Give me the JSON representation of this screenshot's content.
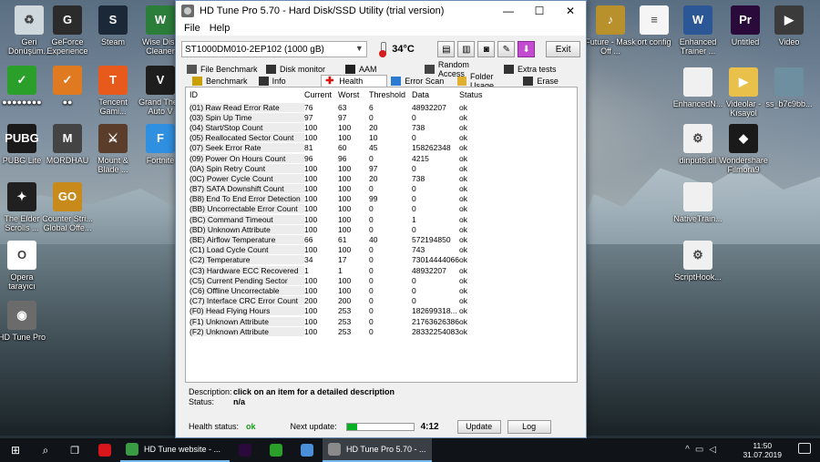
{
  "desktop": {
    "left_icons": [
      {
        "label": "Geri Dönüşüm...",
        "icon": "recycle-bin-icon",
        "color": "#cfd8dc",
        "glyph": "♻"
      },
      {
        "label": "GeForce Experience",
        "icon": "geforce-icon",
        "color": "#2b2b2b",
        "glyph": "G"
      },
      {
        "label": "Steam",
        "icon": "steam-icon",
        "color": "#1b2838",
        "glyph": "S"
      },
      {
        "label": "Wise Disk Cleaner",
        "icon": "wise-disk-cleaner-icon",
        "color": "#2b7d3a",
        "glyph": "W"
      },
      {
        "label": "●●●●●●●●",
        "icon": "check-green-icon",
        "color": "#2aa02a",
        "glyph": "✓"
      },
      {
        "label": "●●",
        "icon": "check-orange-icon",
        "color": "#e07a21",
        "glyph": "✓"
      },
      {
        "label": "Tencent Gami...",
        "icon": "tencent-gaming-icon",
        "color": "#e85a1b",
        "glyph": "T"
      },
      {
        "label": "Grand Theft Auto V",
        "icon": "gta-v-icon",
        "color": "#1e1e1e",
        "glyph": "V"
      },
      {
        "label": "PUBG Lite",
        "icon": "pubg-lite-icon",
        "color": "#1a1a1a",
        "glyph": "PUBG"
      },
      {
        "label": "MORDHAU",
        "icon": "mordhau-icon",
        "color": "#444",
        "glyph": "M"
      },
      {
        "label": "Mount & Blade ...",
        "icon": "mount-blade-icon",
        "color": "#5a3d2b",
        "glyph": "⚔"
      },
      {
        "label": "Fortnite",
        "icon": "fortnite-icon",
        "color": "#2f8fe0",
        "glyph": "F"
      },
      {
        "label": "The Elder Scrolls ...",
        "icon": "elder-scrolls-icon",
        "color": "#202020",
        "glyph": "✦"
      },
      {
        "label": "Counter Stri... Global Offe...",
        "icon": "csgo-icon",
        "color": "#c88a1a",
        "glyph": "GO"
      },
      {
        "label": "Opera tarayıcı",
        "icon": "opera-icon",
        "color": "#ffffff",
        "glyph": "O"
      },
      {
        "label": "HD Tune Pro",
        "icon": "hd-tune-icon",
        "color": "#6b6b6b",
        "glyph": "◉"
      }
    ],
    "right_icons": [
      {
        "label": "Future - Mask Off ...",
        "icon": "image-file-icon",
        "color": "#b8912c",
        "glyph": "♪"
      },
      {
        "label": "ort config",
        "icon": "text-file-icon",
        "color": "#f5f5f5",
        "glyph": "≡"
      },
      {
        "label": "Enhanced Trainer ...",
        "icon": "word-doc-icon",
        "color": "#2b5797",
        "glyph": "W"
      },
      {
        "label": "Untitled",
        "icon": "premiere-project-icon",
        "color": "#2a0a3a",
        "glyph": "Pr"
      },
      {
        "label": "Video",
        "icon": "video-file-icon",
        "color": "#3b3b3b",
        "glyph": "▶"
      },
      {
        "label": "EnhancedN...",
        "icon": "file-icon",
        "color": "#f0f0f0",
        "glyph": ""
      },
      {
        "label": "Videolar - Kısayol",
        "icon": "videos-folder-icon",
        "color": "#e8c04a",
        "glyph": "▶"
      },
      {
        "label": "ss_b7c9bb...",
        "icon": "image-file-icon",
        "color": "#6e8fa0",
        "glyph": ""
      },
      {
        "label": "dinput8.dll",
        "icon": "dll-file-icon",
        "color": "#f0f0f0",
        "glyph": "⚙"
      },
      {
        "label": "Wondershare Filmora9",
        "icon": "filmora-icon",
        "color": "#1a1a1a",
        "glyph": "◆"
      },
      {
        "label": "NativeTrain...",
        "icon": "file-icon",
        "color": "#f0f0f0",
        "glyph": ""
      },
      {
        "label": "ScriptHook...",
        "icon": "dll-file-icon",
        "color": "#f0f0f0",
        "glyph": "⚙"
      }
    ]
  },
  "window": {
    "title": "HD Tune Pro 5.70 - Hard Disk/SSD Utility (trial version)",
    "controls": {
      "minimize": "—",
      "maximize": "☐",
      "close": "✕"
    },
    "menu": [
      "File",
      "Help"
    ],
    "drive": "ST1000DM010-2EP102 (1000 gB)",
    "temperature": "34°C",
    "exit_label": "Exit",
    "tabs_row1": [
      {
        "label": "File Benchmark",
        "icon": "file-benchmark-icon"
      },
      {
        "label": "Disk monitor",
        "icon": "disk-monitor-icon"
      },
      {
        "label": "AAM",
        "icon": "speaker-icon"
      },
      {
        "label": "Random Access",
        "icon": "random-access-icon"
      },
      {
        "label": "Extra tests",
        "icon": "extra-tests-icon"
      }
    ],
    "tabs_row2": [
      {
        "label": "Benchmark",
        "icon": "benchmark-icon"
      },
      {
        "label": "Info",
        "icon": "info-icon"
      },
      {
        "label": "Health",
        "icon": "health-cross-icon"
      },
      {
        "label": "Error Scan",
        "icon": "magnifier-icon"
      },
      {
        "label": "Folder Usage",
        "icon": "folder-icon"
      },
      {
        "label": "Erase",
        "icon": "erase-icon"
      }
    ],
    "active_tab": "Health",
    "table": {
      "headers": [
        "ID",
        "Current",
        "Worst",
        "Threshold",
        "Data",
        "Status"
      ],
      "rows": [
        [
          "(01) Raw Read Error Rate",
          "76",
          "63",
          "6",
          "48932207",
          "ok"
        ],
        [
          "(03) Spin Up Time",
          "97",
          "97",
          "0",
          "0",
          "ok"
        ],
        [
          "(04) Start/Stop Count",
          "100",
          "100",
          "20",
          "738",
          "ok"
        ],
        [
          "(05) Reallocated Sector Count",
          "100",
          "100",
          "10",
          "0",
          "ok"
        ],
        [
          "(07) Seek Error Rate",
          "81",
          "60",
          "45",
          "158262348",
          "ok"
        ],
        [
          "(09) Power On Hours Count",
          "96",
          "96",
          "0",
          "4215",
          "ok"
        ],
        [
          "(0A) Spin Retry Count",
          "100",
          "100",
          "97",
          "0",
          "ok"
        ],
        [
          "(0C) Power Cycle Count",
          "100",
          "100",
          "20",
          "738",
          "ok"
        ],
        [
          "(B7) SATA Downshift Count",
          "100",
          "100",
          "0",
          "0",
          "ok"
        ],
        [
          "(B8) End To End Error Detection",
          "100",
          "100",
          "99",
          "0",
          "ok"
        ],
        [
          "(BB) Uncorrectable Error Count",
          "100",
          "100",
          "0",
          "0",
          "ok"
        ],
        [
          "(BC) Command Timeout",
          "100",
          "100",
          "0",
          "1",
          "ok"
        ],
        [
          "(BD) Unknown Attribute",
          "100",
          "100",
          "0",
          "0",
          "ok"
        ],
        [
          "(BE) Airflow Temperature",
          "66",
          "61",
          "40",
          "572194850",
          "ok"
        ],
        [
          "(C1) Load Cycle Count",
          "100",
          "100",
          "0",
          "743",
          "ok"
        ],
        [
          "(C2) Temperature",
          "34",
          "17",
          "0",
          "73014444066",
          "ok"
        ],
        [
          "(C3) Hardware ECC Recovered",
          "1",
          "1",
          "0",
          "48932207",
          "ok"
        ],
        [
          "(C5) Current Pending Sector",
          "100",
          "100",
          "0",
          "0",
          "ok"
        ],
        [
          "(C6) Offline Uncorrectable",
          "100",
          "100",
          "0",
          "0",
          "ok"
        ],
        [
          "(C7) Interface CRC Error Count",
          "200",
          "200",
          "0",
          "0",
          "ok"
        ],
        [
          "(F0) Head Flying Hours",
          "100",
          "253",
          "0",
          "182699318...",
          "ok"
        ],
        [
          "(F1) Unknown Attribute",
          "100",
          "253",
          "0",
          "21763626386",
          "ok"
        ],
        [
          "(F2) Unknown Attribute",
          "100",
          "253",
          "0",
          "28332254083",
          "ok"
        ]
      ]
    },
    "description_label": "Description:",
    "description_value": "click on an item for a detailed description",
    "status_label": "Status:",
    "status_value": "n/a",
    "health_status_label": "Health status:",
    "health_status_value": "ok",
    "next_update_label": "Next update:",
    "next_update_progress": 0.15,
    "next_update_time": "4:12",
    "update_button": "Update",
    "log_button": "Log"
  },
  "taskbar": {
    "tasks": [
      {
        "label": "",
        "icon": "opera-taskbar-icon",
        "color": "#d8161c"
      },
      {
        "label": "HD Tune website - ...",
        "icon": "chrome-icon",
        "color": "#3a9b45"
      },
      {
        "label": "",
        "icon": "premiere-taskbar-icon",
        "color": "#2a0a3a"
      },
      {
        "label": "",
        "icon": "xbox-icon",
        "color": "#2aa02a"
      },
      {
        "label": "",
        "icon": "monitor-app-icon",
        "color": "#4a90d9"
      },
      {
        "label": "HD Tune Pro 5.70 - ...",
        "icon": "hd-tune-taskbar-icon",
        "color": "#8a8a8a"
      }
    ],
    "time": "11:50",
    "date": "31.07.2019"
  },
  "colors": {
    "accent_blue": "#76b9ed",
    "ok_green": "#1a9a1a",
    "progress_green": "#06b025",
    "thermo_red": "#d41c1c"
  }
}
